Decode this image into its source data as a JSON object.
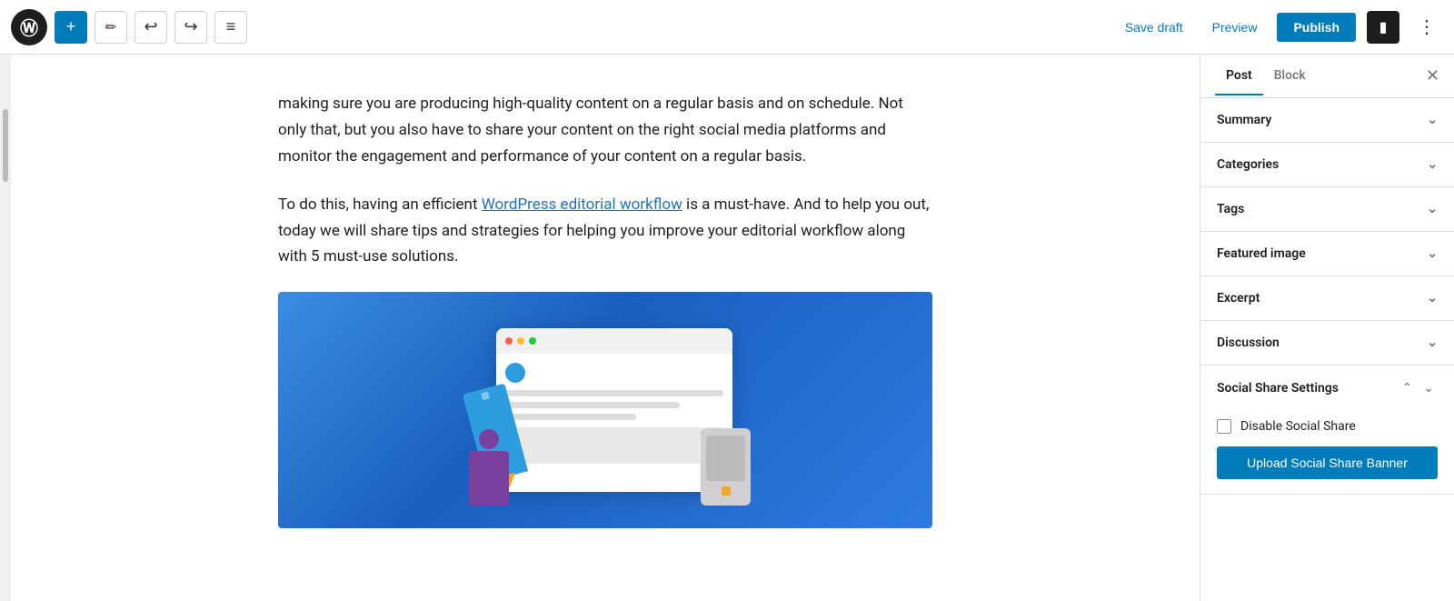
{
  "topbar": {
    "wp_logo": "W",
    "add_label": "+",
    "edit_label": "✎",
    "undo_label": "↩",
    "redo_label": "↪",
    "list_label": "≡",
    "save_draft_label": "Save draft",
    "preview_label": "Preview",
    "publish_label": "Publish",
    "layout_icon": "⬛",
    "more_icon": "⋮"
  },
  "editor": {
    "paragraph1": "making sure you are producing high-quality content on a regular basis and on schedule. Not only that, but you also have to share your content on the right social media platforms and monitor the engagement and performance of your content on a regular basis.",
    "paragraph2_prefix": "To do this, having an efficient ",
    "paragraph2_link": "WordPress editorial workflow",
    "paragraph2_suffix": " is a must-have. And to help you out, today we will share tips and strategies for helping you improve your editorial workflow along with 5 must-use solutions."
  },
  "panel": {
    "tab_post": "Post",
    "tab_block": "Block",
    "close_label": "✕",
    "accordion_items": [
      {
        "label": "Summary",
        "expanded": false
      },
      {
        "label": "Categories",
        "expanded": false
      },
      {
        "label": "Tags",
        "expanded": false
      },
      {
        "label": "Featured image",
        "expanded": false
      },
      {
        "label": "Excerpt",
        "expanded": false
      },
      {
        "label": "Discussion",
        "expanded": false
      }
    ],
    "social_share": {
      "title": "Social Share Settings",
      "disable_label": "Disable Social Share",
      "upload_label": "Upload Social Share Banner"
    }
  }
}
